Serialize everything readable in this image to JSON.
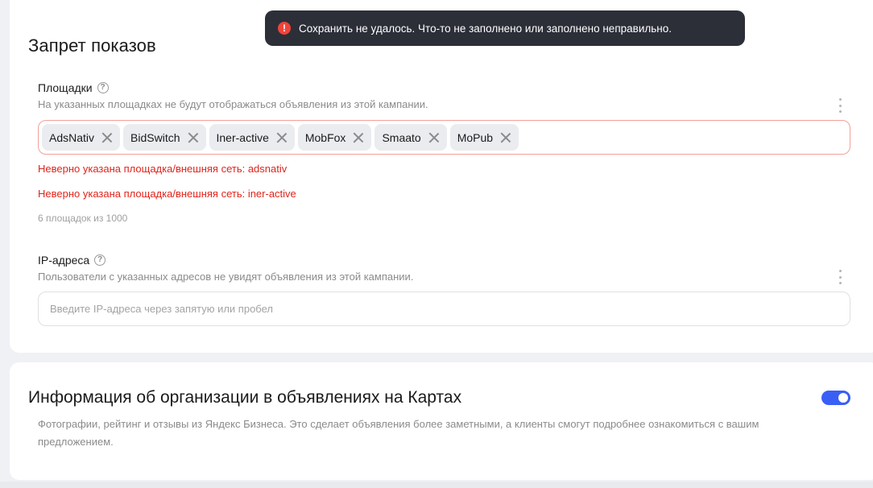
{
  "toast": {
    "icon": "error-icon",
    "message": "Сохранить не удалось. Что-то не заполнено или заполнено неправильно."
  },
  "exclusions": {
    "title": "Запрет показов",
    "platforms": {
      "label": "Площадки",
      "hint": "На указанных площадках не будут отображаться объявления из этой кампании.",
      "tags": [
        "AdsNativ",
        "BidSwitch",
        "Iner-active",
        "MobFox",
        "Smaato",
        "MoPub"
      ],
      "errors": [
        "Неверно указана площадка/внешняя сеть: adsnativ",
        "Неверно указана площадка/внешняя сеть: iner-active"
      ],
      "counter": "6 площадок из 1000"
    },
    "ip": {
      "label": "IP-адреса",
      "hint": "Пользователи с указанных адресов не увидят объявления из этой кампании.",
      "value": "",
      "placeholder": "Введите IP-адреса через запятую или пробел"
    }
  },
  "maps": {
    "title": "Информация об организации в объявлениях на Картах",
    "description": "Фотографии, рейтинг и отзывы из Яндекс Бизнеса. Это сделает объявления более заметными, а клиенты смогут подробнее ознакомиться с вашим предложением.",
    "toggle_on": true
  },
  "colors": {
    "accent": "#3a5ff5",
    "error": "#e0241b",
    "toast_bg": "#2c2f38"
  }
}
